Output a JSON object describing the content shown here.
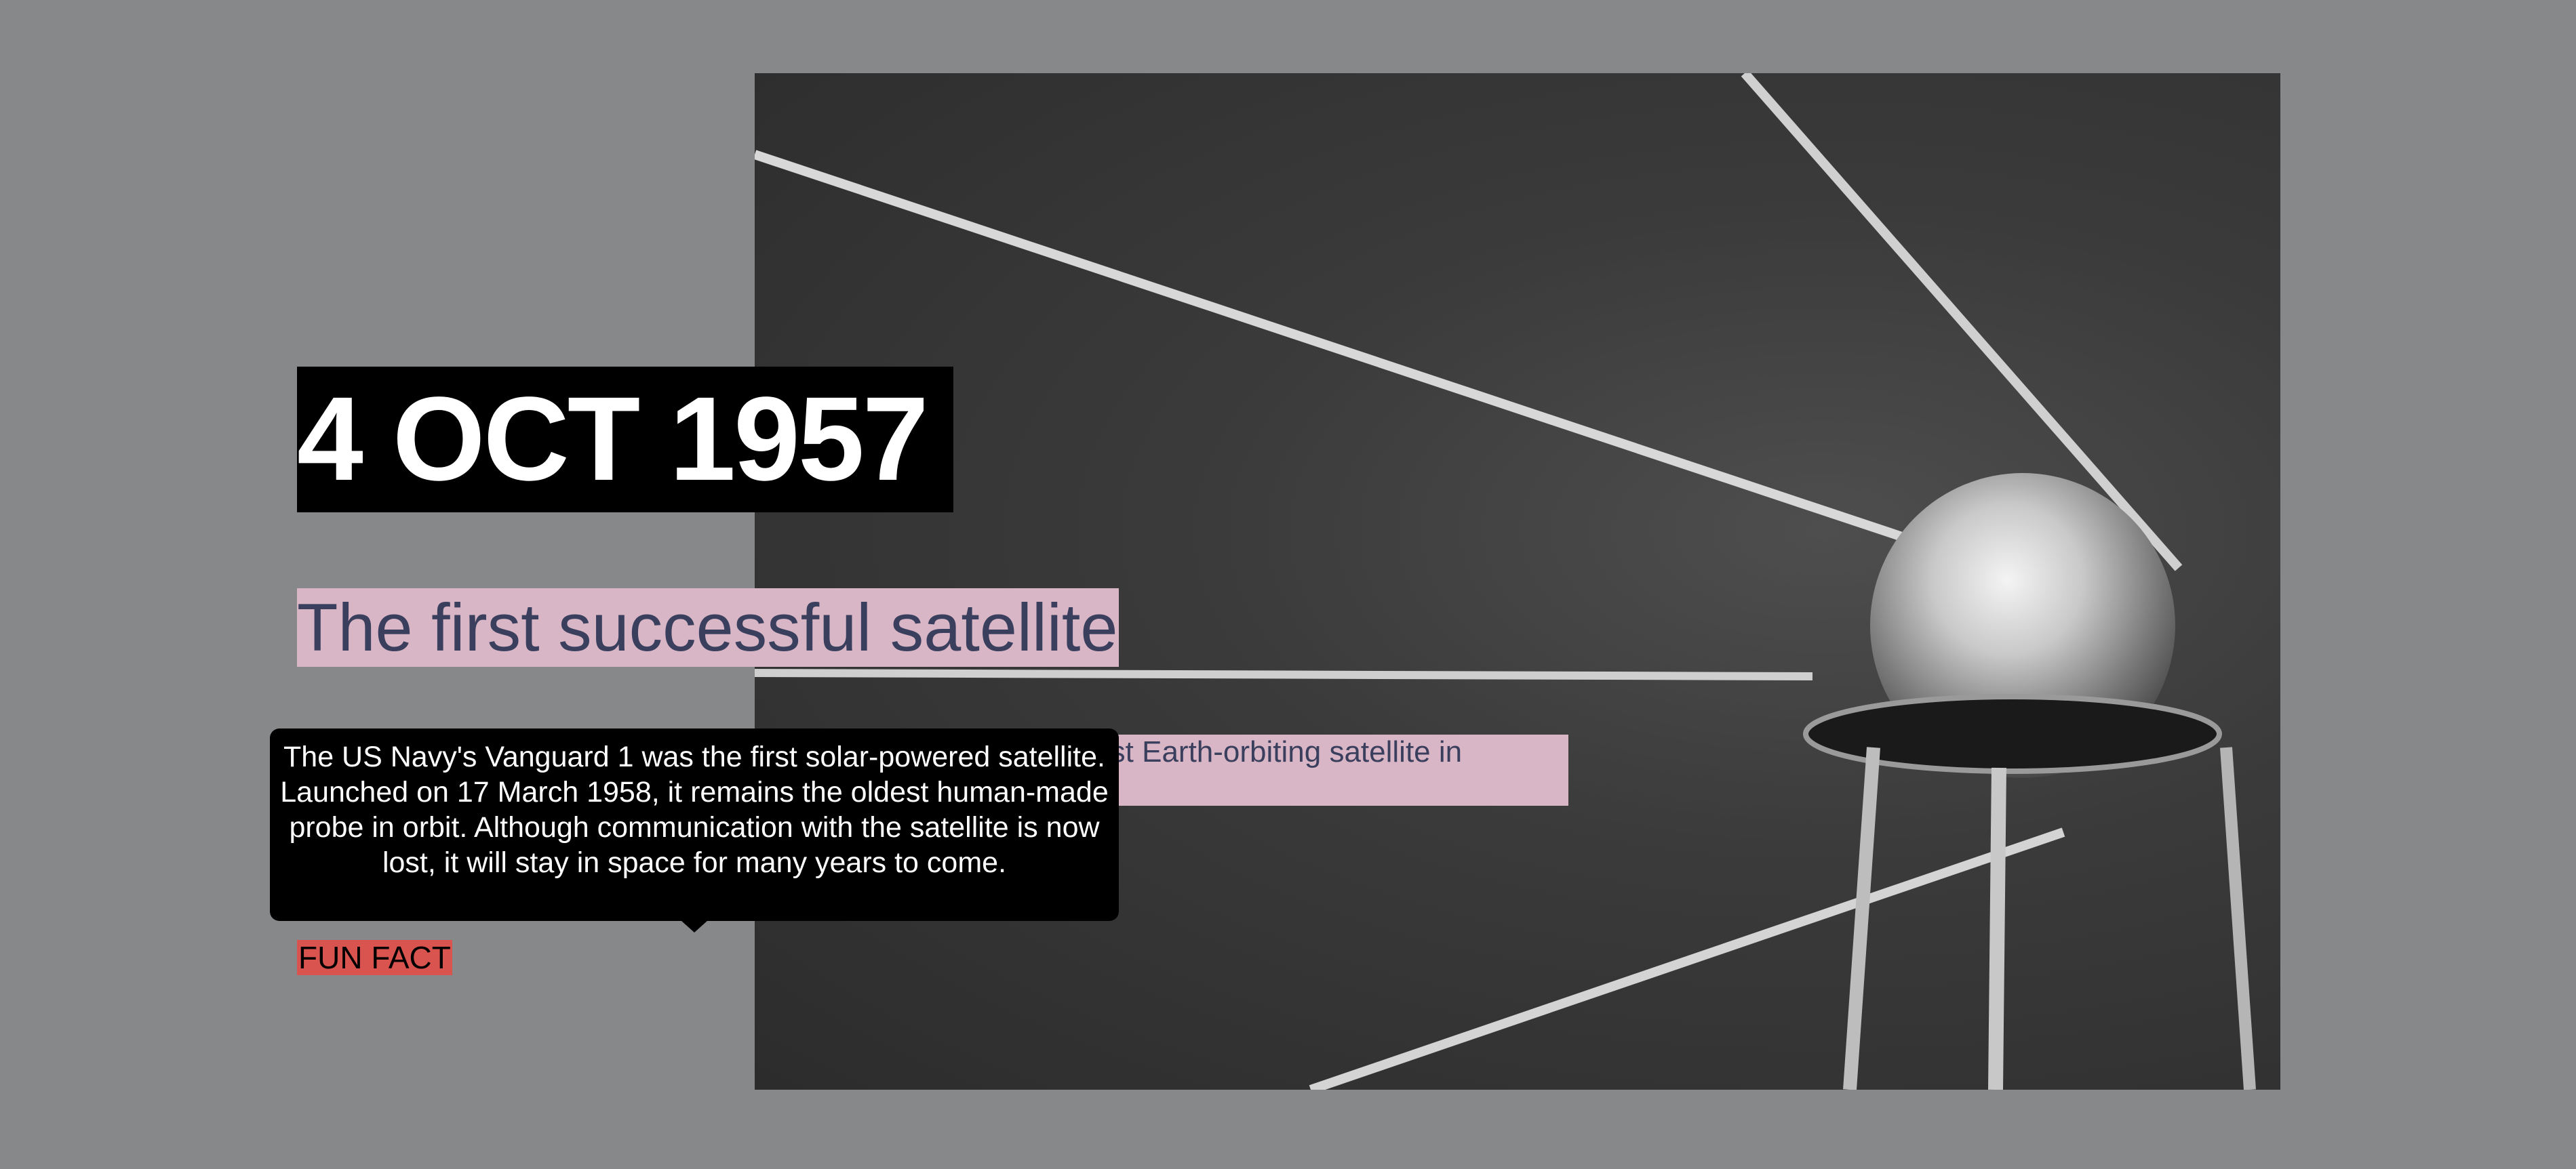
{
  "slide": {
    "date": "4 OCT 1957",
    "subtitle": "The first successful satellite",
    "description_visible": "rst Earth-orbiting satellite in",
    "tooltip_text": "The US Navy's Vanguard 1 was the first solar-powered satellite. Launched on 17 March 1958, it remains the oldest human-made probe in orbit. Although communication with the satellite is now lost, it will stay in space for many years to come.",
    "fun_fact_label": "FUN FACT"
  },
  "colors": {
    "background": "#87888a",
    "date_box": "#000000",
    "highlight": "#d8b6c6",
    "subtitle_text": "#3b3f5e",
    "fun_fact": "#d9534f"
  },
  "icons": {
    "photo": "sputnik-satellite-image"
  }
}
